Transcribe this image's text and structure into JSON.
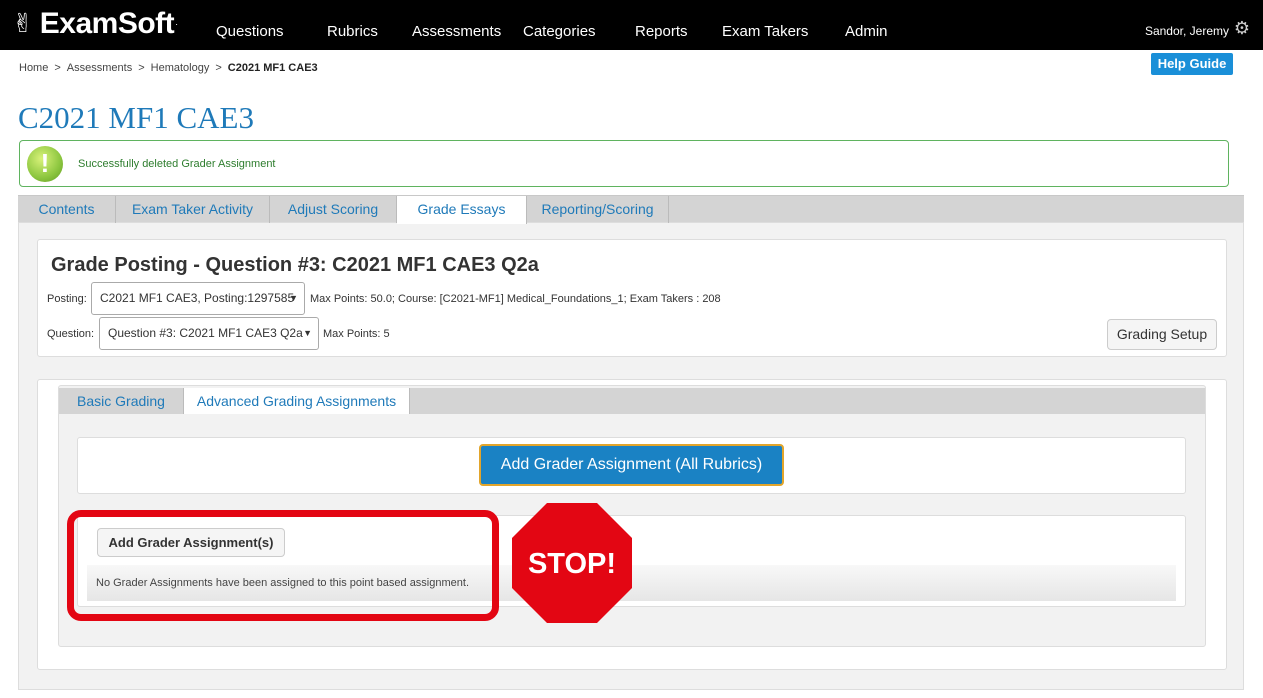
{
  "brand": {
    "logo_text": "ExamSoft",
    "logo_glyph": "✌",
    "tm": "·"
  },
  "nav": {
    "items": [
      {
        "label": "Questions"
      },
      {
        "label": "Rubrics"
      },
      {
        "label": "Assessments"
      },
      {
        "label": "Categories"
      },
      {
        "label": "Reports"
      },
      {
        "label": "Exam Takers"
      },
      {
        "label": "Admin"
      }
    ],
    "user": "Sandor, Jeremy",
    "settings_icon": "gear-icon"
  },
  "breadcrumb": {
    "items": [
      "Home",
      "Assessments",
      "Hematology"
    ],
    "separator": ">",
    "current": "C2021 MF1 CAE3"
  },
  "help_guide": "Help Guide",
  "page_title": "C2021 MF1 CAE3",
  "alert": {
    "text": "Successfully deleted Grader Assignment",
    "icon": "exclamation-icon",
    "color": "#5fb35f"
  },
  "tabs": [
    {
      "label": "Contents"
    },
    {
      "label": "Exam Taker Activity"
    },
    {
      "label": "Adjust Scoring"
    },
    {
      "label": "Grade Essays",
      "active": true
    },
    {
      "label": "Reporting/Scoring"
    }
  ],
  "grade_posting": {
    "title": "Grade Posting - Question #3: C2021 MF1 CAE3 Q2a",
    "posting_label": "Posting:",
    "posting_value": "C2021 MF1 CAE3, Posting:1297585",
    "posting_info": "Max Points:  50.0; Course:  [C2021-MF1] Medical_Foundations_1; Exam Takers : 208",
    "question_label": "Question:",
    "question_value": "Question #3: C2021 MF1 CAE3 Q2a",
    "question_info": "Max Points: 5",
    "grading_setup": "Grading Setup"
  },
  "sub_tabs": [
    {
      "label": "Basic Grading"
    },
    {
      "label": "Advanced Grading Assignments",
      "active": true
    }
  ],
  "add_all_rubrics": "Add Grader Assignment (All Rubrics)",
  "add_assignments": "Add Grader Assignment(s)",
  "empty_message": "No Grader Assignments have been assigned to this point based assignment.",
  "stop_sign": {
    "text": "STOP!",
    "color": "#e30613"
  },
  "colors": {
    "accent": "#1f7ab9",
    "button_blue": "#1a82c4",
    "button_border": "#e2a52b",
    "highlight": "#e30613"
  }
}
